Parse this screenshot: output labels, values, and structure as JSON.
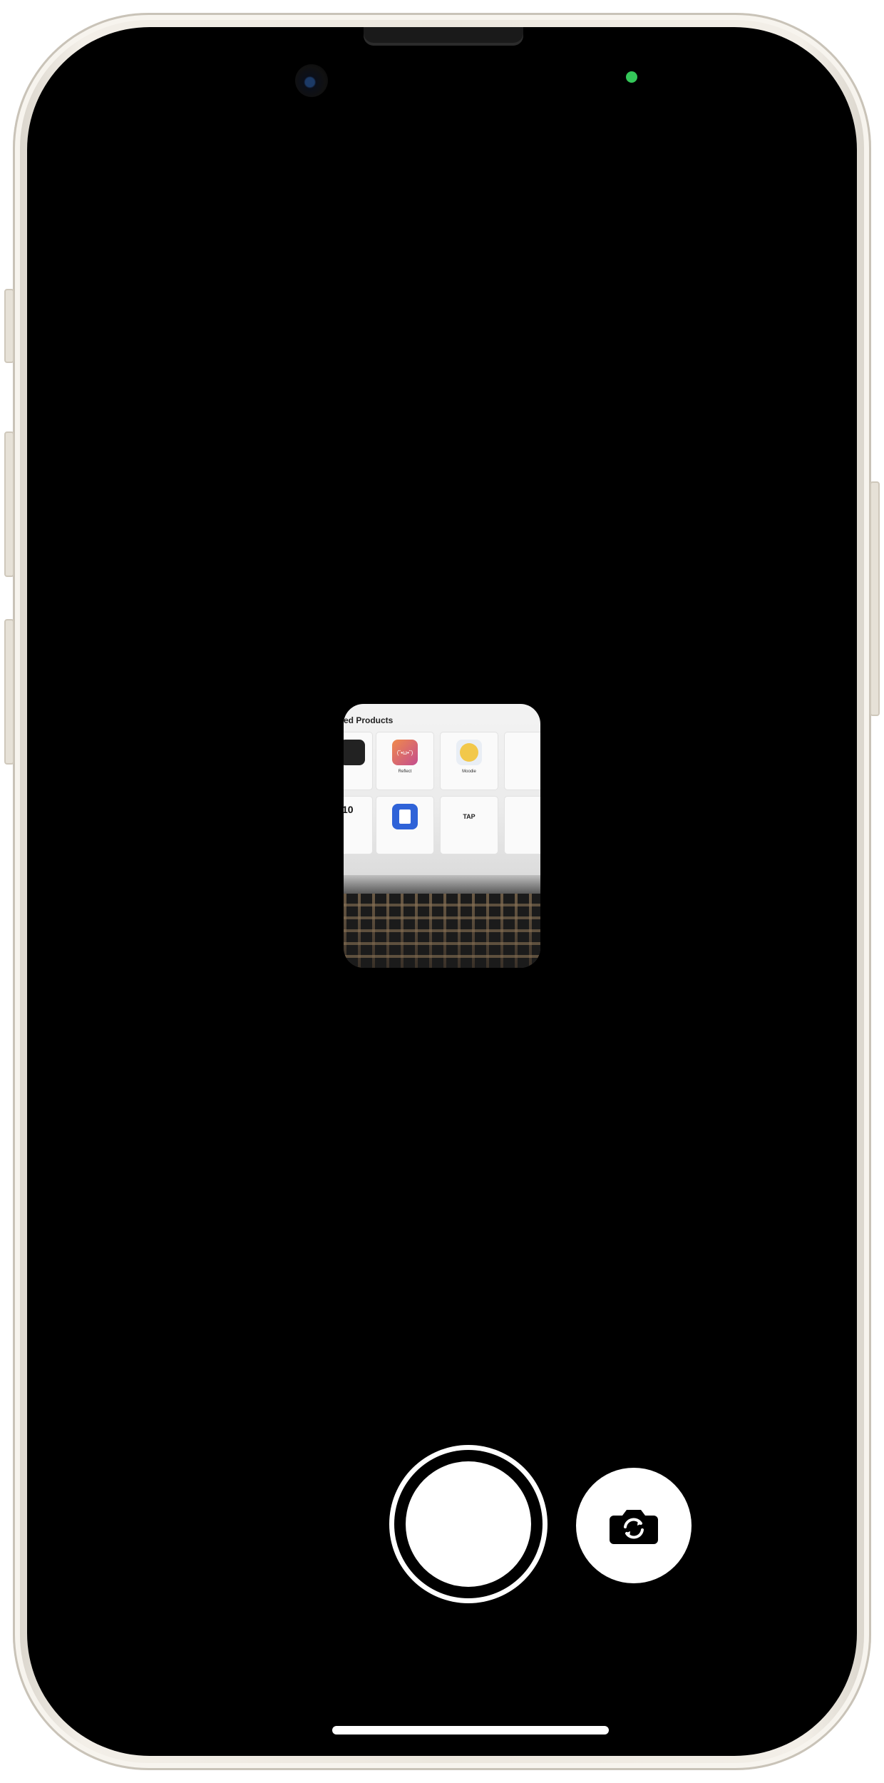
{
  "preview": {
    "heading": "ed Products",
    "tiles": [
      {
        "title": "",
        "subtitle": ""
      },
      {
        "title": "Reflect",
        "subtitle": ""
      },
      {
        "title": "Moodie",
        "subtitle": ""
      },
      {
        "title": "",
        "subtitle": ""
      },
      {
        "title": "",
        "subtitle": ""
      },
      {
        "title": "",
        "subtitle": ""
      },
      {
        "title": "",
        "subtitle": ""
      }
    ],
    "tap_label": "TAP",
    "kaomoji": "(˘•ω•˘)",
    "ten_label": "10"
  },
  "controls": {
    "shutter": "shutter-button",
    "flip": "camera-flip-icon"
  },
  "colors": {
    "privacy_indicator": "#34c759",
    "frame": "#ece7de",
    "screen": "#000000"
  }
}
